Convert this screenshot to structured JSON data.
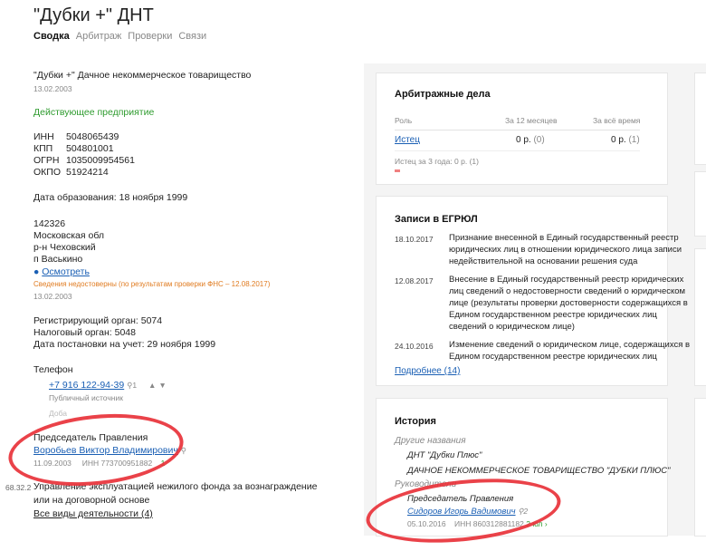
{
  "header": {
    "title": "\"Дубки +\" ДНТ",
    "tabs": [
      "Сводка",
      "Арбитраж",
      "Проверки",
      "Связи"
    ]
  },
  "company": {
    "full_name": "\"Дубки +\" Дачное некоммерческое товарищество",
    "name_date": "13.02.2003",
    "status": "Действующее предприятие",
    "ids": [
      {
        "label": "ИНН",
        "value": "5048065439"
      },
      {
        "label": "КПП",
        "value": "504801001"
      },
      {
        "label": "ОГРН",
        "value": "1035009954561"
      },
      {
        "label": "ОКПО",
        "value": "51924214"
      }
    ],
    "founded": "Дата образования: 18 ноября 1999",
    "address": [
      "142326",
      "Московская обл",
      "р-н Чеховский",
      "п Васькино"
    ],
    "map_link": "Осмотреть",
    "address_warning": "Сведения недостоверны (по результатам проверки ФНС – 12.08.2017)",
    "address_date": "13.02.2003",
    "registry": [
      "Регистрирующий орган: 5074",
      "Налоговый орган: 5048",
      "Дата постановки на учет: 29 ноября 1999"
    ],
    "phone_label": "Телефон",
    "phone": "+7 916 122-94-39",
    "phone_count": "1",
    "phone_source": "Публичный источник",
    "phone_add": "Доба",
    "chairman_title": "Председатель Правления",
    "chairman_name": "Воробьев Виктор Владимирович",
    "chairman_date": "11.09.2003",
    "chairman_inn": "ИНН 773700951882",
    "chairman_count": "1",
    "activity_code": "68.32.2",
    "activity": "Управление эксплуатацией нежилого фонда за вознаграждение или на договорной основе",
    "all_activities": "Все виды деятельности (4)"
  },
  "arbitration": {
    "title": "Арбитражные дела",
    "col_role": "Роль",
    "col_12m": "За 12 месяцев",
    "col_all": "За всё время",
    "row_role": "Истец",
    "row_12m": "0 р.",
    "row_12m_count": "(0)",
    "row_all": "0 р.",
    "row_all_count": "(1)",
    "note": "Истец за 3 года: 0 р. (1)"
  },
  "egrul": {
    "title": "Записи в ЕГРЮЛ",
    "entries": [
      {
        "date": "18.10.2017",
        "lines": [
          "Признание внесенной в Единый государственный реестр",
          "юридических лиц в отношении юридического лица записи",
          "недействительной на основании решения суда"
        ]
      },
      {
        "date": "12.08.2017",
        "lines": [
          "Внесение в Единый государственный реестр юридических",
          "лиц сведений о недостоверности сведений о юридическом",
          "лице (результаты проверки достоверности содержащихся в",
          "Едином государственном реестре юридических лиц",
          "сведений о юридическом лице)"
        ]
      },
      {
        "date": "24.10.2016",
        "lines": [
          "Изменение сведений о юридическом лице, содержащихся в",
          "Едином государственном реестре юридических лиц"
        ]
      }
    ],
    "more": "Подробнее (14)"
  },
  "history": {
    "title": "История",
    "other_names_label": "Другие названия",
    "other_names": [
      "ДНТ \"Дубки Плюс\"",
      "ДАЧНОЕ НЕКОММЕРЧЕСКОЕ ТОВАРИЩЕСТВО \"ДУБКИ ПЛЮС\""
    ],
    "leaders_label": "Руководители",
    "leader_title": "Председатель Правления",
    "leader_name": "Сидоров Игорь Вадимович",
    "leader_count": "2",
    "leader_date": "05.10.2016",
    "leader_inn": "ИНН 860312881182",
    "leader_until": "2 юл"
  },
  "colors": {
    "link": "#1a5fb4",
    "active_status": "#2e9b2e",
    "warning": "#e07b20",
    "annotation": "#e8323a"
  }
}
